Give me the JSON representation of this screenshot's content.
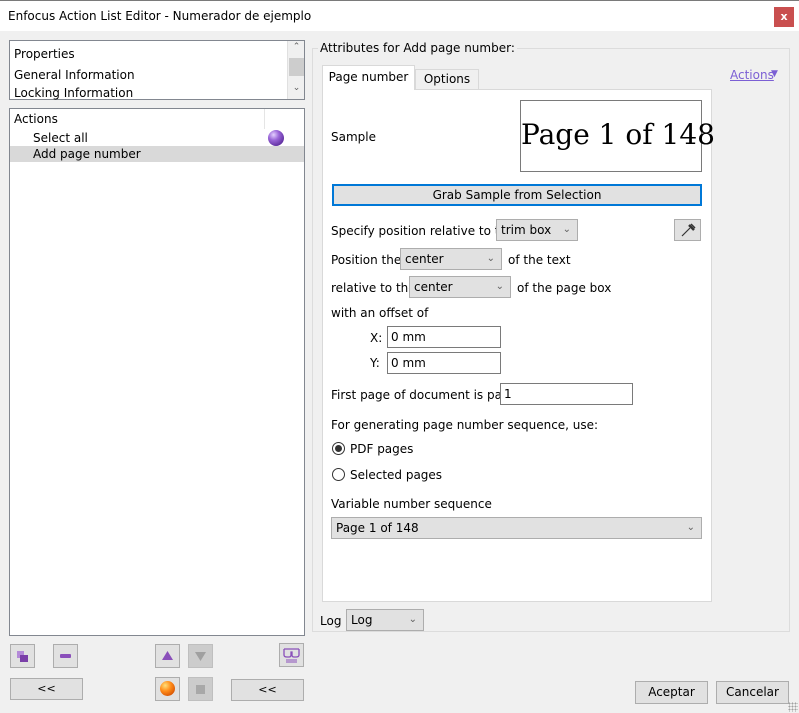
{
  "window": {
    "title": "Enfocus Action List Editor - Numerador de ejemplo",
    "close_label": "x"
  },
  "properties_panel": {
    "items": [
      "Properties",
      "General Information",
      "Locking Information"
    ]
  },
  "actions_panel": {
    "header": "Actions",
    "rows": [
      {
        "label": "Select all",
        "selected": false,
        "status_icon": "purple-sphere-icon"
      },
      {
        "label": "Add page number",
        "selected": true,
        "status_icon": ""
      }
    ]
  },
  "left_toolbar": {
    "collapse_left_label": "<<",
    "collapse_right_label": "<<"
  },
  "attributes": {
    "group_title": "Attributes for Add page number:",
    "actions_link": "Actions",
    "tabs": [
      {
        "label": "Page number",
        "active": true
      },
      {
        "label": "Options",
        "active": false
      }
    ],
    "sample_label": "Sample",
    "sample_text": "Page 1 of 148",
    "grab_button": "Grab Sample from Selection",
    "specify_position_label": "Specify position relative to the",
    "box_select": "trim box",
    "position_the_label": "Position the",
    "text_anchor_select": "center",
    "of_the_text_label": "of the text",
    "relative_to_label": "relative to the",
    "page_anchor_select": "center",
    "of_page_box_label": "of the page box",
    "offset_label": "with an offset of",
    "x_label": "X:",
    "x_value": "0 mm",
    "y_label": "Y:",
    "y_value": "0 mm",
    "first_page_label": "First page of document is page",
    "first_page_value": "1",
    "sequence_label": "For generating page number sequence, use:",
    "radio_options": [
      {
        "label": "PDF pages",
        "checked": true
      },
      {
        "label": "Selected pages",
        "checked": false
      }
    ],
    "variable_sequence_label": "Variable number sequence",
    "variable_sequence_select": "Page 1 of 148",
    "log_label": "Log",
    "log_select": "Log"
  },
  "footer": {
    "ok_button": "Aceptar",
    "cancel_button": "Cancelar"
  },
  "colors": {
    "accent_blue": "#0078d7",
    "link_purple": "#7b5fd4",
    "close_red": "#c94f4f",
    "selection_gray": "#d9d9d9"
  }
}
